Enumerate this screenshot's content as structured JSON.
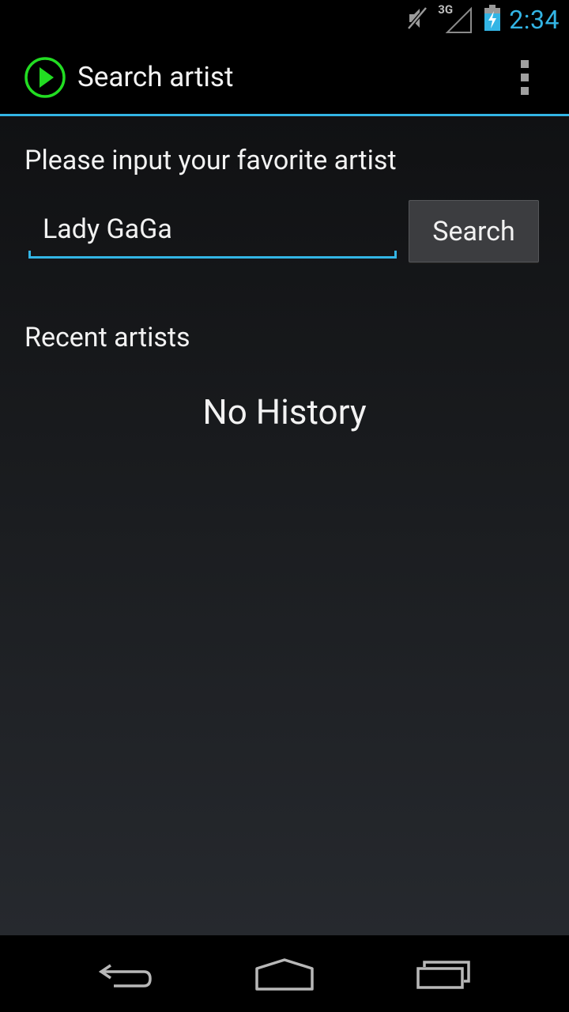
{
  "status_bar": {
    "time": "2:34",
    "network_label": "3G",
    "icons": [
      "muted-speaker-icon",
      "signal-3g-icon",
      "battery-charging-icon"
    ],
    "accent_color": "#33b5e5"
  },
  "action_bar": {
    "title": "Search artist",
    "app_icon": "play-circle-icon",
    "app_icon_color": "#22dd22",
    "overflow_icon": "overflow-menu-icon",
    "divider_color": "#33b5e5"
  },
  "form": {
    "prompt": "Please input your favorite artist",
    "search_value": "Lady GaGa",
    "search_placeholder": "",
    "search_button_label": "Search"
  },
  "recent": {
    "heading": "Recent artists",
    "empty_text": "No History"
  },
  "nav_bar": {
    "icons": [
      "back-icon",
      "home-icon",
      "recent-apps-icon"
    ]
  }
}
